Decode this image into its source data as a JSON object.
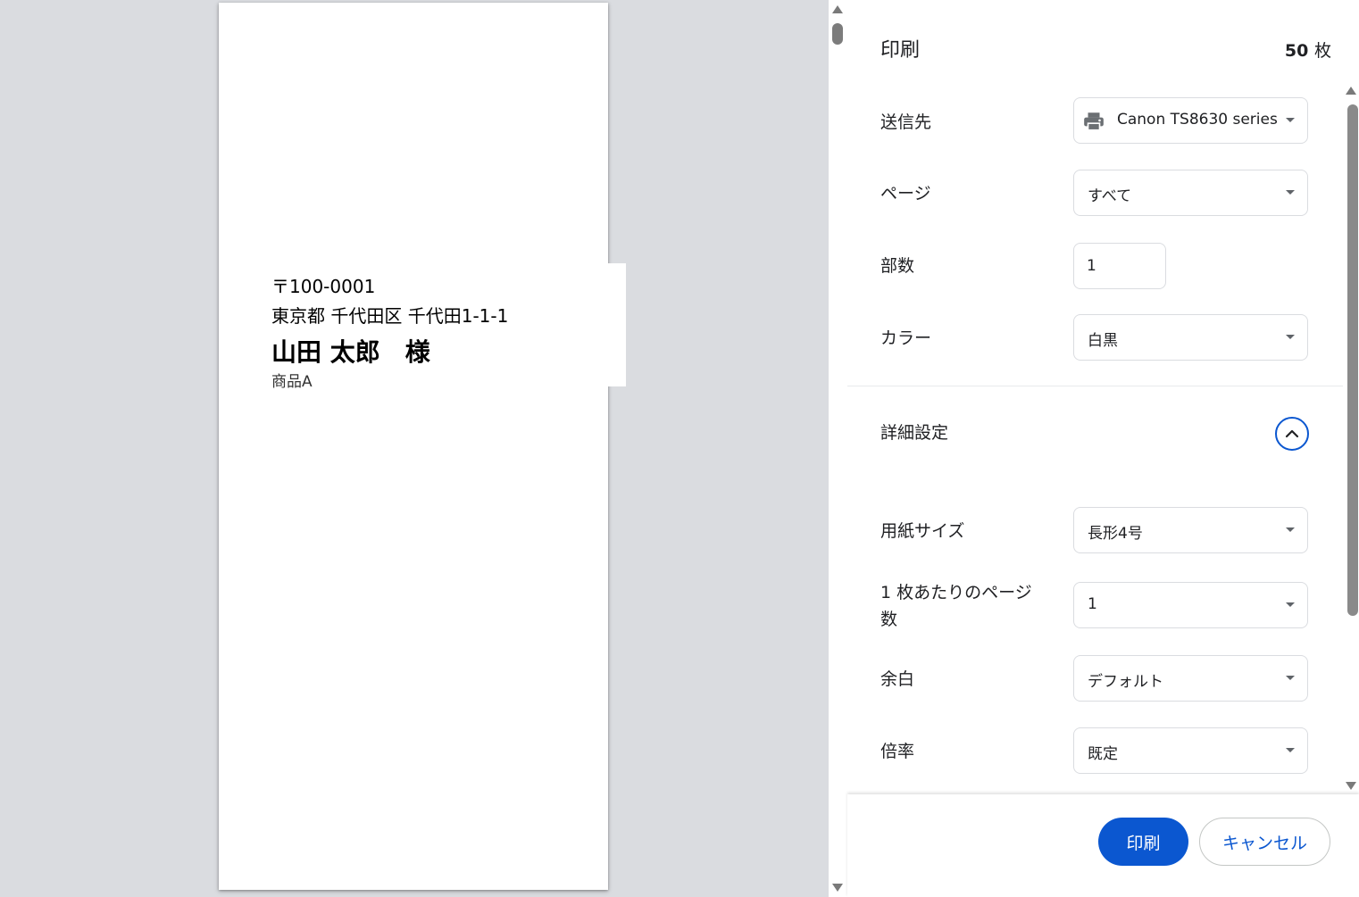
{
  "preview": {
    "postal": "〒100-0001",
    "address": "東京都 千代田区 千代田1-1-1",
    "name": "山田 太郎　様",
    "item": "商品A"
  },
  "panel": {
    "title": "印刷",
    "sheet_count": "50",
    "sheet_unit": "枚",
    "destination_label": "送信先",
    "destination_value": "Canon TS8630 series",
    "pages_label": "ページ",
    "pages_value": "すべて",
    "copies_label": "部数",
    "copies_value": "1",
    "color_label": "カラー",
    "color_value": "白黒",
    "advanced_label": "詳細設定",
    "paper_size_label": "用紙サイズ",
    "paper_size_value": "長形4号",
    "pages_per_sheet_label_line1": "1 枚あたりのページ",
    "pages_per_sheet_label_line2": "数",
    "pages_per_sheet_value": "1",
    "margins_label": "余白",
    "margins_value": "デフォルト",
    "scale_label": "倍率",
    "scale_value": "既定"
  },
  "footer": {
    "print_label": "印刷",
    "cancel_label": "キャンセル"
  },
  "colors": {
    "accent": "#0b57d0",
    "preview_bg": "#dadce0"
  },
  "icons": [
    "printer-icon",
    "chevron-up-icon",
    "dropdown-caret-icon"
  ]
}
